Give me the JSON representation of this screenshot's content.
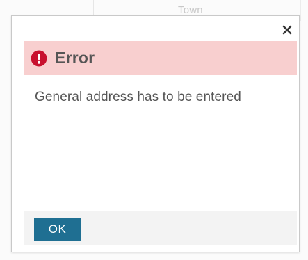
{
  "background": {
    "column_label": "Town"
  },
  "dialog": {
    "title": "Error",
    "message": "General address has to be entered",
    "ok_label": "OK",
    "close_icon": "close-icon",
    "error_icon": "exclamation-circle-icon",
    "colors": {
      "header_bg": "#f8cfcf",
      "error_icon": "#c8102e",
      "ok_button": "#1f6f92",
      "text": "#555555"
    }
  }
}
